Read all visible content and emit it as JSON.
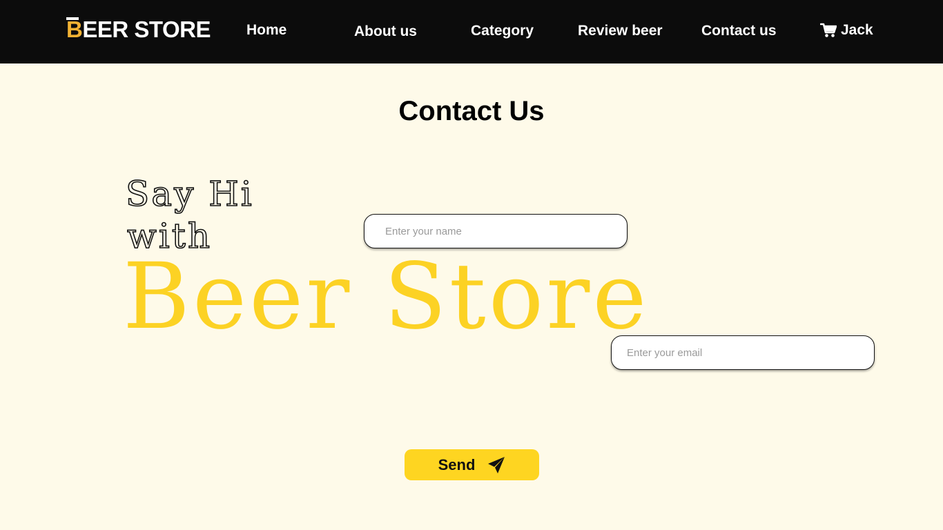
{
  "navbar": {
    "logo_first_letter": "B",
    "logo_rest": "EER STORE",
    "links": {
      "home": "Home",
      "about": "About us",
      "category": "Category",
      "review": "Review beer",
      "contact": "Contact us"
    },
    "user_name": "Jack",
    "cart_icon": "shopping-cart-icon"
  },
  "page": {
    "title": "Contact Us"
  },
  "hero": {
    "line1": "Say Hi",
    "line2": "with",
    "brand": "Beer Store"
  },
  "form": {
    "name_placeholder": "Enter your name",
    "email_placeholder": "Enter your email",
    "send_label": "Send",
    "send_icon": "paper-plane-icon"
  },
  "colors": {
    "navbar_bg": "#0c0c0c",
    "page_bg": "#fefae9",
    "accent_yellow": "#fed521",
    "logo_orange": "#f2b233"
  }
}
